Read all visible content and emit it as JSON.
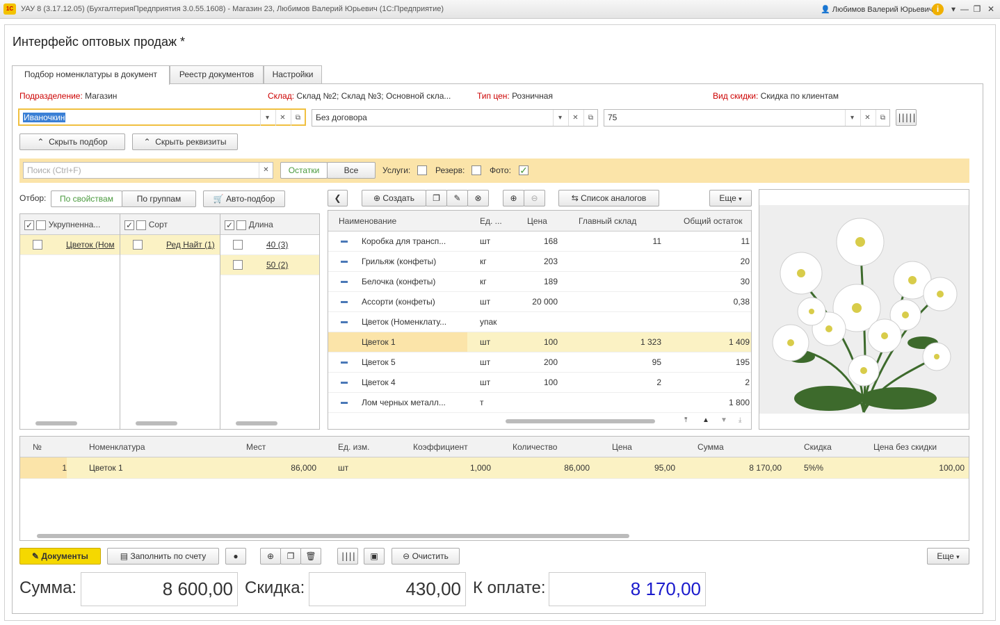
{
  "window": {
    "title": "УАУ 8 (3.17.12.05) (БухгалтерияПредприятия 3.0.55.1608) - Магазин 23, Любимов Валерий Юрьевич  (1С:Предприятие)",
    "user": "Любимов Валерий Юрьевич",
    "logo": "1С"
  },
  "page": {
    "title": "Интерфейс оптовых продаж *"
  },
  "tabs": [
    {
      "label": "Подбор номенклатуры в документ"
    },
    {
      "label": "Реестр документов"
    },
    {
      "label": "Настройки"
    }
  ],
  "header": {
    "division_label": "Подразделение:",
    "division_value": "Магазин",
    "warehouse_label": "Склад:",
    "warehouse_value": "Склад №2; Склад №3; Основной скла...",
    "price_label": "Тип цен:",
    "price_value": "Розничная",
    "discount_label": "Вид скидки:",
    "discount_value": "Скидка по клиентам"
  },
  "fields": {
    "client": "Иваночкин",
    "contract": "Без договора",
    "third": "75"
  },
  "buttons": {
    "hide_selection": "Скрыть подбор",
    "hide_details": "Скрыть реквизиты"
  },
  "searchbar": {
    "placeholder": "Поиск (Ctrl+F)",
    "toggle_stock": "Остатки",
    "toggle_all": "Все",
    "services": "Услуги:",
    "reserve": "Резерв:",
    "photo": "Фото:"
  },
  "filter": {
    "label": "Отбор:",
    "by_props": "По свойствам",
    "by_groups": "По группам",
    "auto": "Авто-подбор"
  },
  "filter_cols": [
    {
      "header": "Укрупненна...",
      "items": [
        {
          "label": "Цветок (Ном"
        }
      ]
    },
    {
      "header": "Сорт",
      "items": [
        {
          "label": "Ред Найт (1)"
        }
      ]
    },
    {
      "header": "Длина",
      "items": [
        {
          "label": "40 (3)"
        },
        {
          "label": "50 (2)"
        }
      ]
    }
  ],
  "toolbar": {
    "create": "Создать",
    "analogs": "Список аналогов",
    "more": "Еще"
  },
  "products": {
    "headers": [
      "Наименование",
      "Ед. ...",
      "Цена",
      "Главный склад",
      "Общий остаток"
    ],
    "rows": [
      [
        "Коробка для трансп...",
        "шт",
        "168",
        "11",
        "11"
      ],
      [
        "Грильяж (конфеты)",
        "кг",
        "203",
        "",
        "20"
      ],
      [
        "Белочка (конфеты)",
        "кг",
        "189",
        "",
        "30"
      ],
      [
        "Ассорти (конфеты)",
        "шт",
        "20 000",
        "",
        "0,38"
      ],
      [
        "Цветок (Номенклату...",
        "упак",
        "",
        "",
        ""
      ],
      [
        "Цветок 1",
        "шт",
        "100",
        "1 323",
        "1 409"
      ],
      [
        "Цветок 5",
        "шт",
        "200",
        "95",
        "195"
      ],
      [
        "Цветок 4",
        "шт",
        "100",
        "2",
        "2"
      ],
      [
        "Лом черных металл...",
        "т",
        "",
        "",
        "1 800"
      ]
    ]
  },
  "doc": {
    "headers": [
      "№",
      "Номенклатура",
      "Мест",
      "Ед. изм.",
      "Коэффициент",
      "Количество",
      "Цена",
      "Сумма",
      "Скидка",
      "Цена без скидки"
    ],
    "rows": [
      [
        "1",
        "Цветок 1",
        "86,000",
        "шт",
        "1,000",
        "86,000",
        "95,00",
        "8 170,00",
        "5%%",
        "100,00"
      ]
    ]
  },
  "bottom": {
    "documents": "Документы",
    "fill": "Заполнить по счету",
    "clear": "Очистить",
    "more": "Еще"
  },
  "totals": {
    "sum_label": "Сумма:",
    "sum": "8 600,00",
    "disc_label": "Скидка:",
    "disc": "430,00",
    "pay_label": "К оплате:",
    "pay": "8 170,00"
  },
  "colors": {
    "accent": "#4a9a3e",
    "highlight": "#fbe4a9",
    "pay": "#1a1acc"
  }
}
